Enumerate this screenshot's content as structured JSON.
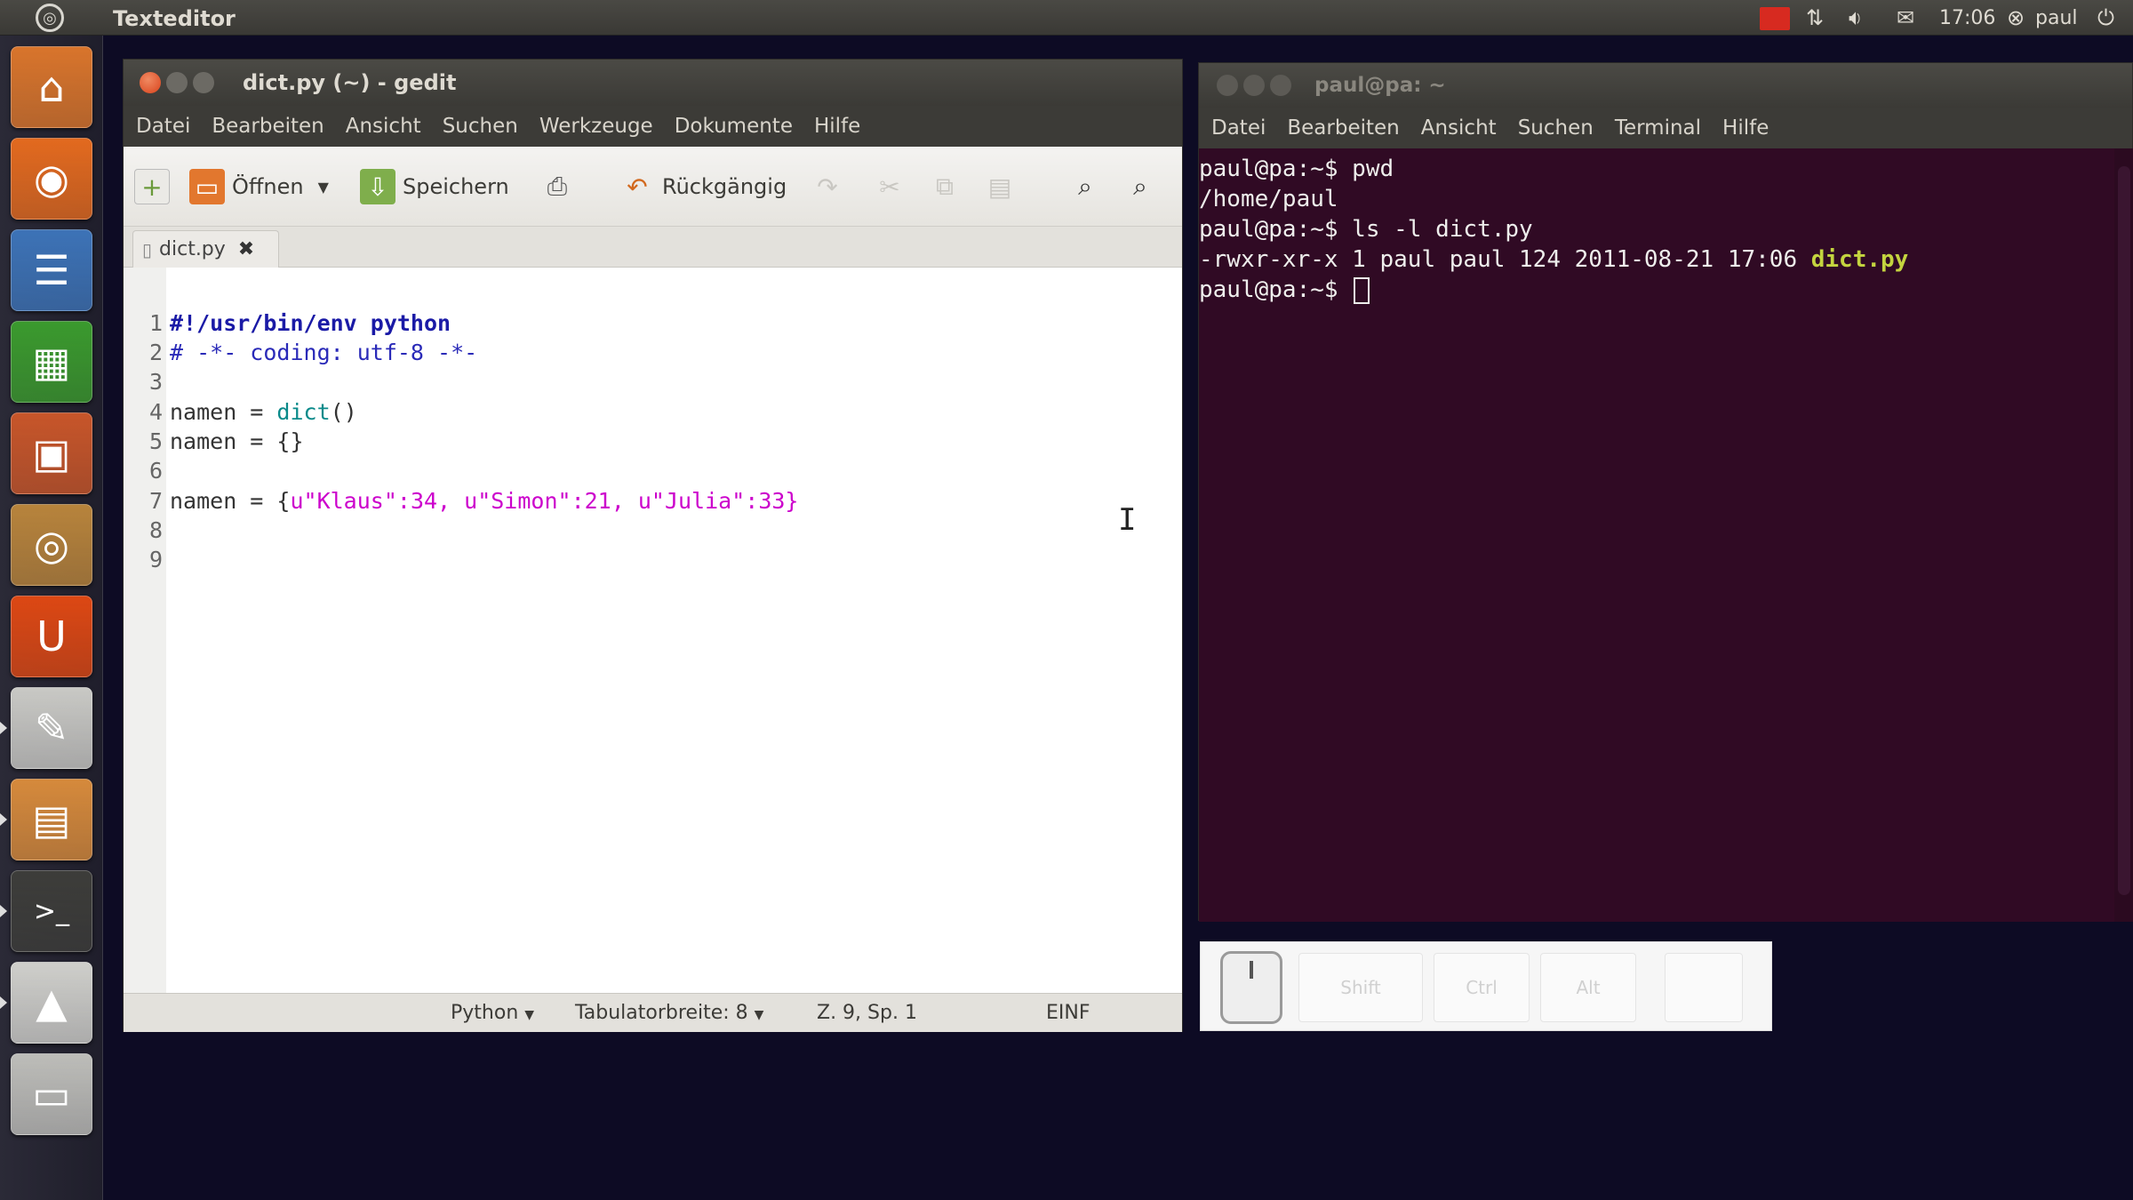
{
  "top_panel": {
    "app_title": "Texteditor",
    "clock": "17:06",
    "user": "paul",
    "icons": [
      "ubuntu-logo-icon",
      "alert-icon",
      "network-icon",
      "volume-icon",
      "mail-icon",
      "user-icon",
      "power-icon"
    ]
  },
  "launcher": {
    "items": [
      {
        "name": "home-folder-icon",
        "color": "#d9752c",
        "glyph": "⌂"
      },
      {
        "name": "firefox-icon",
        "color": "#e36a1f",
        "glyph": "◉"
      },
      {
        "name": "writer-icon",
        "color": "#3d73b7",
        "glyph": "☰"
      },
      {
        "name": "calc-icon",
        "color": "#3b9a2e",
        "glyph": "▦"
      },
      {
        "name": "impress-icon",
        "color": "#c8562a",
        "glyph": "▣"
      },
      {
        "name": "software-center-icon",
        "color": "#b8843c",
        "glyph": "◎"
      },
      {
        "name": "ubuntu-one-icon",
        "color": "#dd4814",
        "glyph": "U"
      },
      {
        "name": "text-editor-icon",
        "color": "#c9c9c5",
        "glyph": "✎"
      },
      {
        "name": "files-icon",
        "color": "#d68a3c",
        "glyph": "▤"
      },
      {
        "name": "terminal-icon",
        "color": "#3d3d3a",
        "glyph": ">_"
      },
      {
        "name": "screenshot-icon",
        "color": "#cfcfcb",
        "glyph": "▲"
      },
      {
        "name": "system-icon",
        "color": "#bdbdb9",
        "glyph": "▭"
      }
    ]
  },
  "gedit": {
    "title": "dict.py (~) - gedit",
    "menu": [
      "Datei",
      "Bearbeiten",
      "Ansicht",
      "Suchen",
      "Werkzeuge",
      "Dokumente",
      "Hilfe"
    ],
    "toolbar": {
      "open_label": "Öffnen",
      "save_label": "Speichern",
      "undo_label": "Rückgängig"
    },
    "tab_label": "dict.py",
    "line_numbers": [
      "1",
      "2",
      "3",
      "4",
      "5",
      "6",
      "7",
      "8",
      "9"
    ],
    "code": {
      "l1": "#!/usr/bin/env python",
      "l2": "# -*- coding: utf-8 -*-",
      "l4_a": "namen = ",
      "l4_b": "dict",
      "l4_c": "()",
      "l5": "namen = {}",
      "l7_a": "namen = {",
      "l7_s1": "u\"Klaus\"",
      "l7_b": ":34, ",
      "l7_s2": "u\"Simon\"",
      "l7_c": ":21, ",
      "l7_s3": "u\"Julia\"",
      "l7_d": ":33}"
    },
    "status": {
      "language": "Python",
      "tab_width": "Tabulatorbreite: 8",
      "position": "Z. 9, Sp. 1",
      "mode": "EINF"
    }
  },
  "terminal": {
    "title": "paul@pa: ~",
    "menu": [
      "Datei",
      "Bearbeiten",
      "Ansicht",
      "Suchen",
      "Terminal",
      "Hilfe"
    ],
    "lines": {
      "l1": "paul@pa:~$ pwd",
      "l2": "/home/paul",
      "l3": "paul@pa:~$ ls -l dict.py",
      "l4_a": "-rwxr-xr-x 1 paul paul 124 2011-08-21 17:06 ",
      "l4_file": "dict.py",
      "l5": "paul@pa:~$ "
    }
  },
  "key_display": {
    "keys": [
      "Shift",
      "Ctrl",
      "Alt",
      ""
    ]
  },
  "colors": {
    "terminal_bg": "#300a24",
    "close_button": "#e2532a",
    "desktop_bg": "#0d0b24"
  }
}
